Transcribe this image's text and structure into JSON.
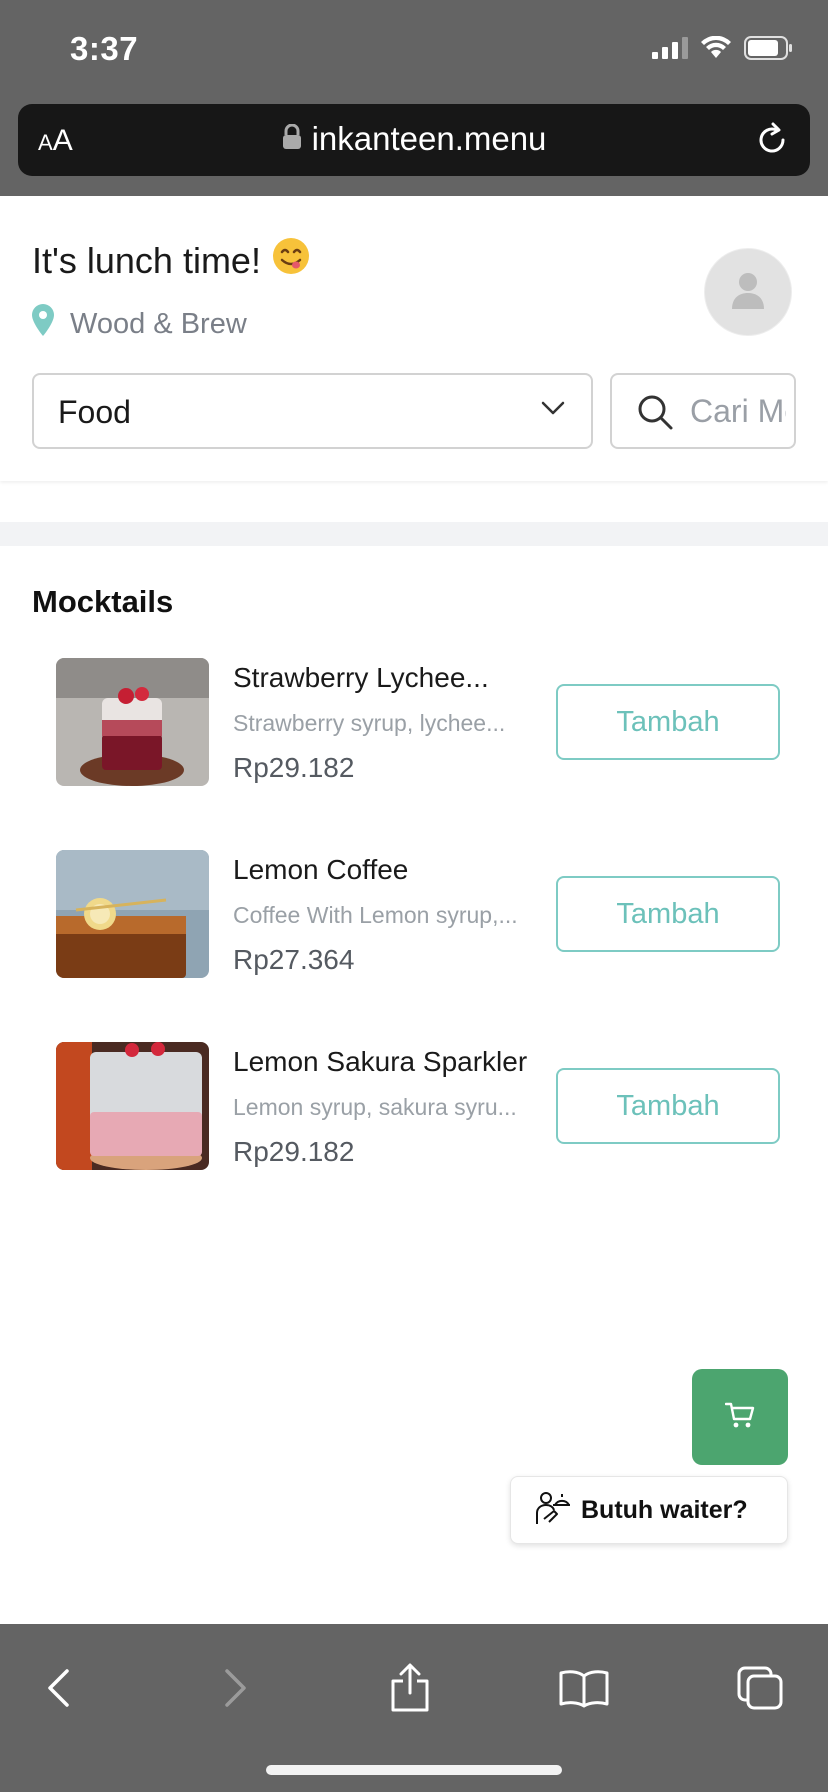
{
  "status_bar": {
    "time": "3:37"
  },
  "browser": {
    "text_size_label": "AA",
    "url": "inkanteen.menu"
  },
  "header": {
    "greeting": "It's lunch time!",
    "location": "Wood & Brew",
    "category_selected": "Food",
    "search_placeholder": "Cari Menu"
  },
  "section": {
    "title": "Mocktails"
  },
  "items": [
    {
      "name": "Strawberry Lychee...",
      "description": "Strawberry syrup, lychee...",
      "price": "Rp29.182",
      "button": "Tambah"
    },
    {
      "name": "Lemon Coffee",
      "description": "Coffee With Lemon syrup,...",
      "price": "Rp27.364",
      "button": "Tambah"
    },
    {
      "name": "Lemon Sakura Sparkler",
      "description": "Lemon syrup, sakura syru...",
      "price": "Rp29.182",
      "button": "Tambah"
    }
  ],
  "floating": {
    "waiter_label": "Butuh waiter?"
  },
  "colors": {
    "accent": "#6cc1ba",
    "cart": "#4ca56f",
    "chrome": "#646464"
  },
  "icons": [
    "signal-icon",
    "wifi-icon",
    "battery-icon",
    "lock-icon",
    "reload-icon",
    "location-pin-icon",
    "avatar-icon",
    "chevron-down-icon",
    "search-icon",
    "cart-icon",
    "waiter-icon",
    "back-icon",
    "forward-icon",
    "share-icon",
    "bookmarks-icon",
    "tabs-icon"
  ]
}
